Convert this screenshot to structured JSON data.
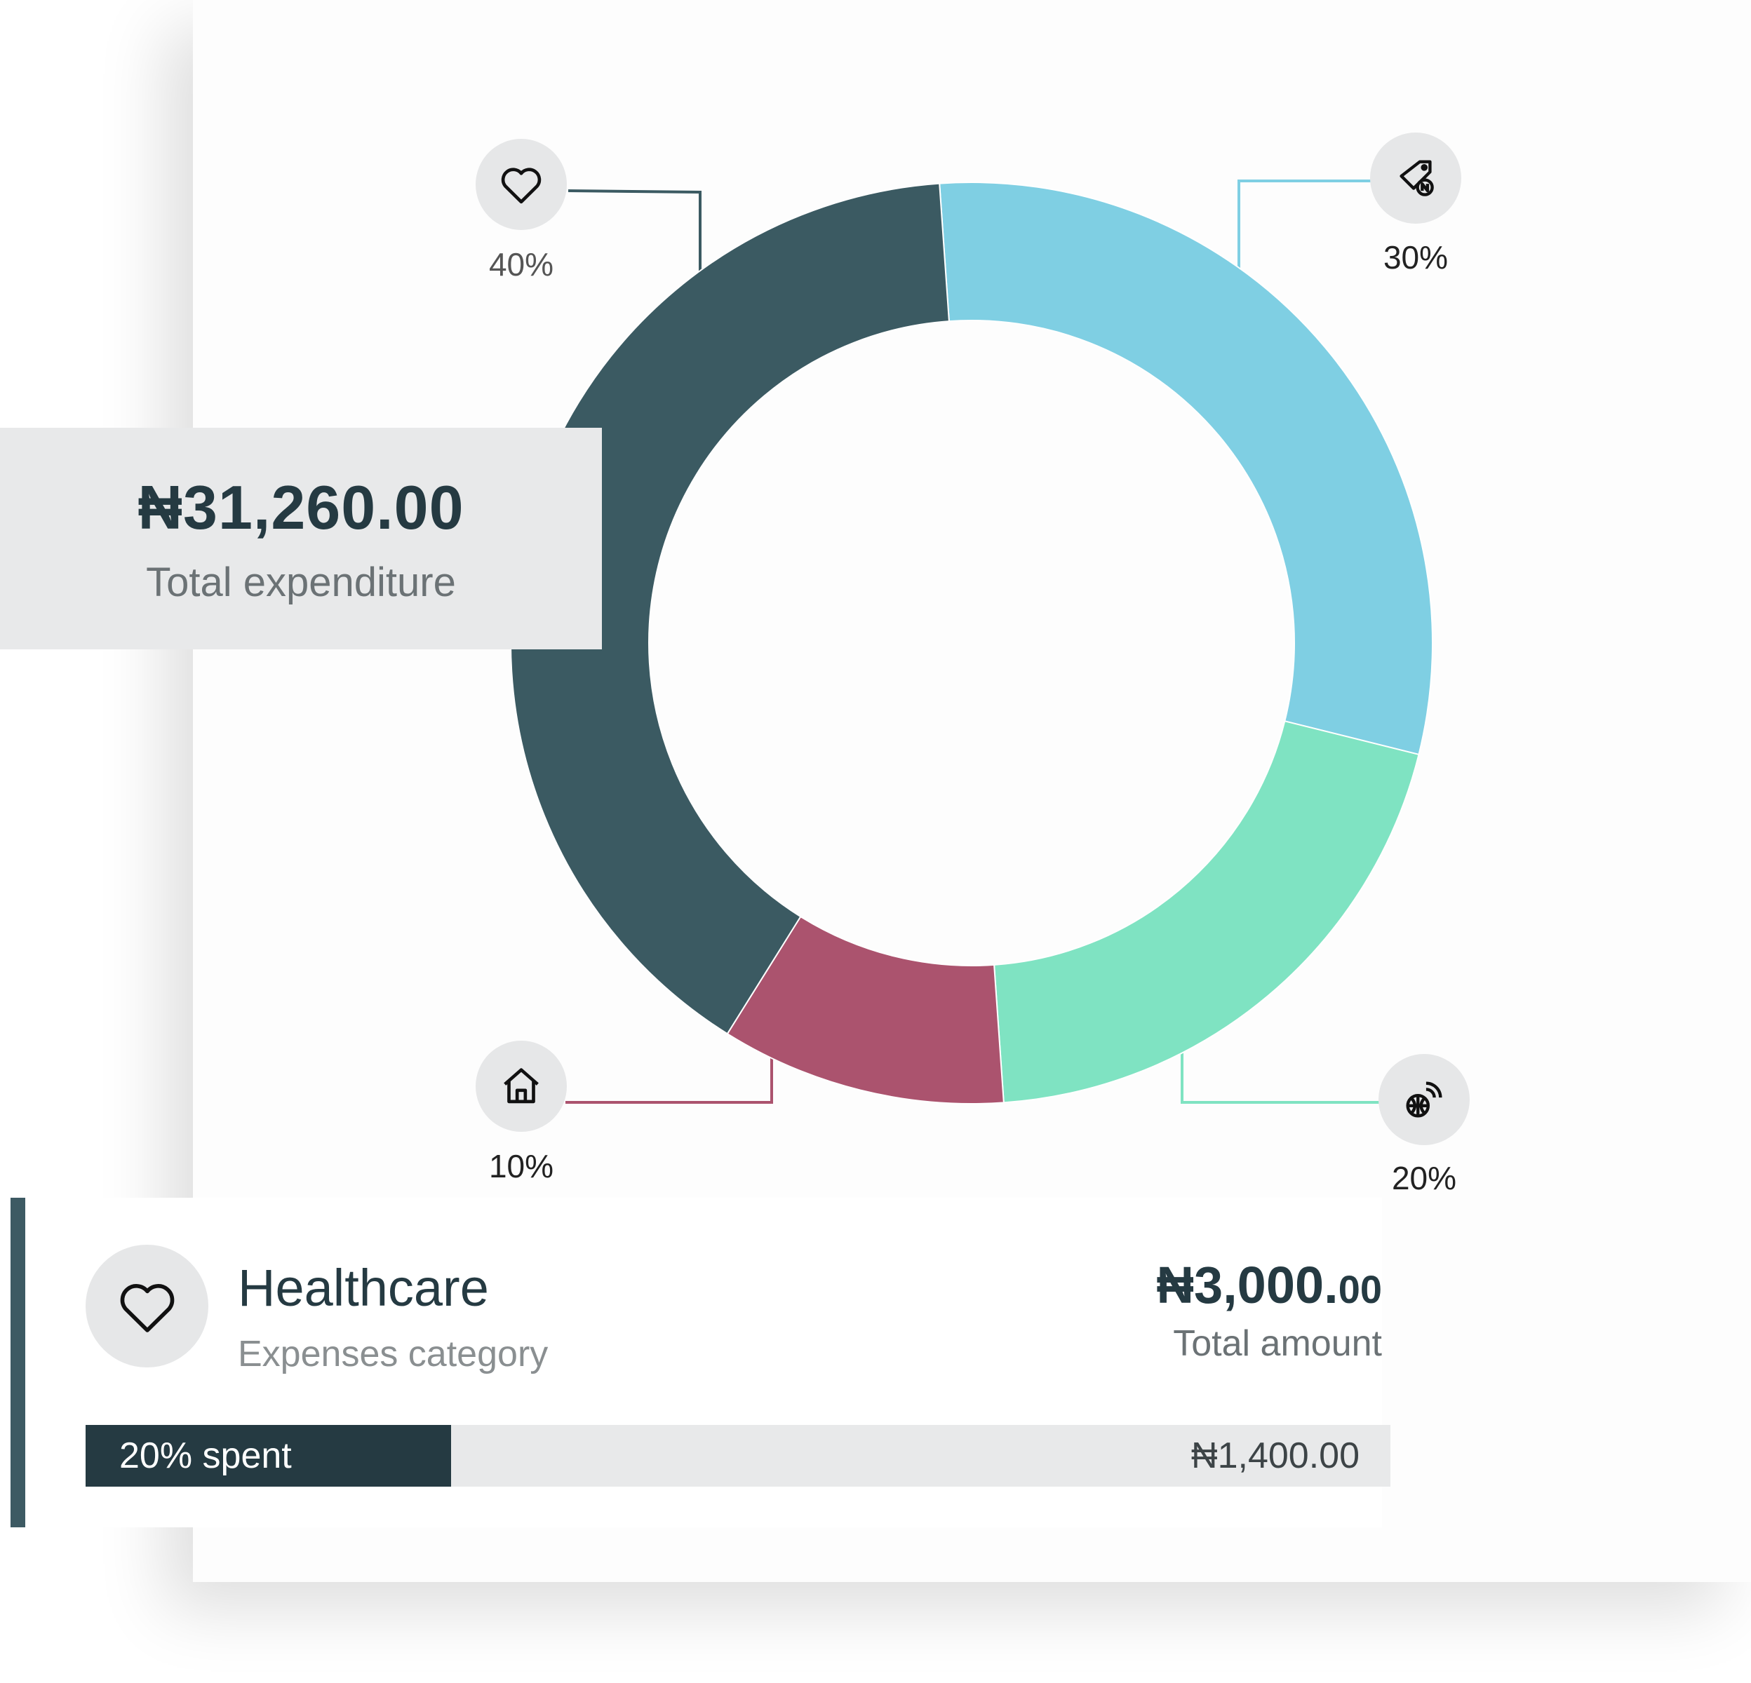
{
  "chart_data": {
    "type": "pie",
    "style": "donut",
    "slices": [
      {
        "label": "30%",
        "value": 30,
        "color": "#7fcfe3",
        "icon": "money-tag-icon"
      },
      {
        "label": "20%",
        "value": 20,
        "color": "#7fe3c2",
        "icon": "globe-wifi-icon"
      },
      {
        "label": "10%",
        "value": 10,
        "color": "#ab536e",
        "icon": "home-icon"
      },
      {
        "label": "40%",
        "value": 40,
        "color": "#3b5a62",
        "icon": "heart-icon"
      }
    ]
  },
  "summary": {
    "amount": "₦31,260.00",
    "label": "Total expenditure"
  },
  "category": {
    "icon": "heart-icon",
    "name": "Healthcare",
    "subtitle": "Expenses category",
    "amount_main": "₦3,000.",
    "amount_cents": "00",
    "amount_label": "Total amount",
    "progress_text": "20% spent",
    "progress_fraction": 0.28,
    "remaining": "₦1,400.00"
  },
  "colors": {
    "dark": "#253a42",
    "accent_bar": "#3d5a63"
  }
}
